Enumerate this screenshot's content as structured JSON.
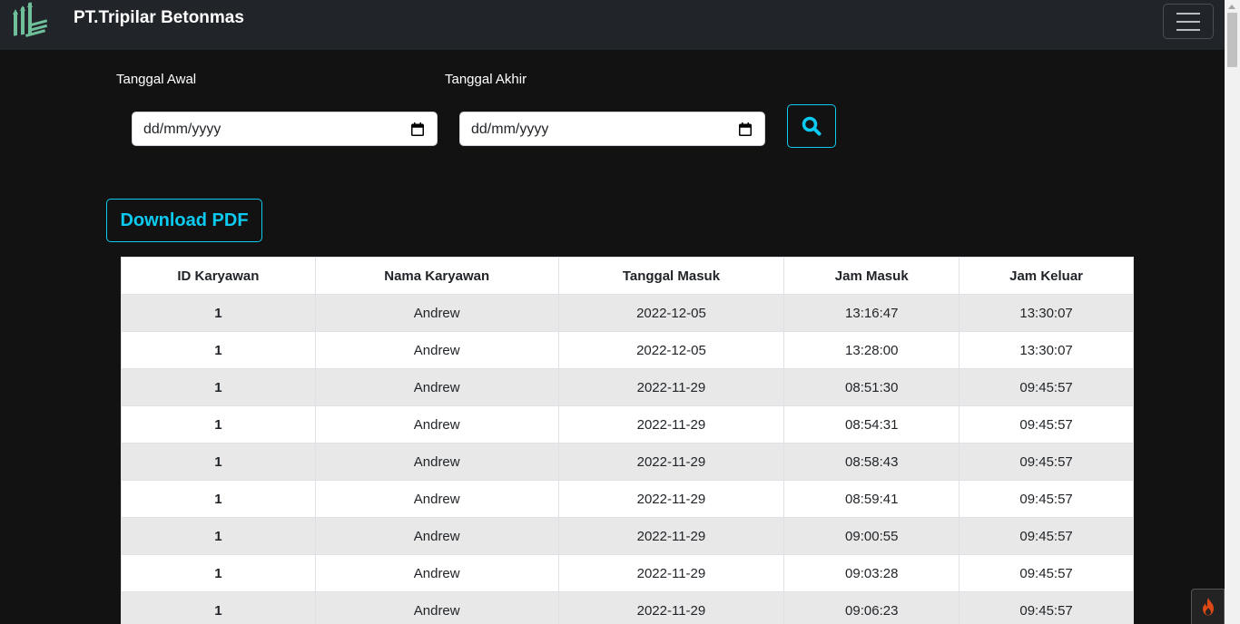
{
  "navbar": {
    "brand": "PT.Tripilar Betonmas"
  },
  "filter": {
    "start_label": "Tanggal Awal",
    "end_label": "Tanggal Akhir",
    "start_placeholder": "dd/mm/yyyy",
    "end_placeholder": "dd/mm/yyyy"
  },
  "actions": {
    "download_pdf": "Download PDF"
  },
  "table": {
    "headers": [
      "ID Karyawan",
      "Nama Karyawan",
      "Tanggal Masuk",
      "Jam Masuk",
      "Jam Keluar"
    ],
    "rows": [
      [
        "1",
        "Andrew",
        "2022-12-05",
        "13:16:47",
        "13:30:07"
      ],
      [
        "1",
        "Andrew",
        "2022-12-05",
        "13:28:00",
        "13:30:07"
      ],
      [
        "1",
        "Andrew",
        "2022-11-29",
        "08:51:30",
        "09:45:57"
      ],
      [
        "1",
        "Andrew",
        "2022-11-29",
        "08:54:31",
        "09:45:57"
      ],
      [
        "1",
        "Andrew",
        "2022-11-29",
        "08:58:43",
        "09:45:57"
      ],
      [
        "1",
        "Andrew",
        "2022-11-29",
        "08:59:41",
        "09:45:57"
      ],
      [
        "1",
        "Andrew",
        "2022-11-29",
        "09:00:55",
        "09:45:57"
      ],
      [
        "1",
        "Andrew",
        "2022-11-29",
        "09:03:28",
        "09:45:57"
      ],
      [
        "1",
        "Andrew",
        "2022-11-29",
        "09:06:23",
        "09:45:57"
      ]
    ]
  },
  "colors": {
    "accent": "#0dcaf0",
    "navbar": "#212529",
    "background": "#121212"
  },
  "icons": {
    "search": "search-icon",
    "calendar": "calendar-icon",
    "menu": "hamburger-icon",
    "debug": "flame-icon"
  }
}
